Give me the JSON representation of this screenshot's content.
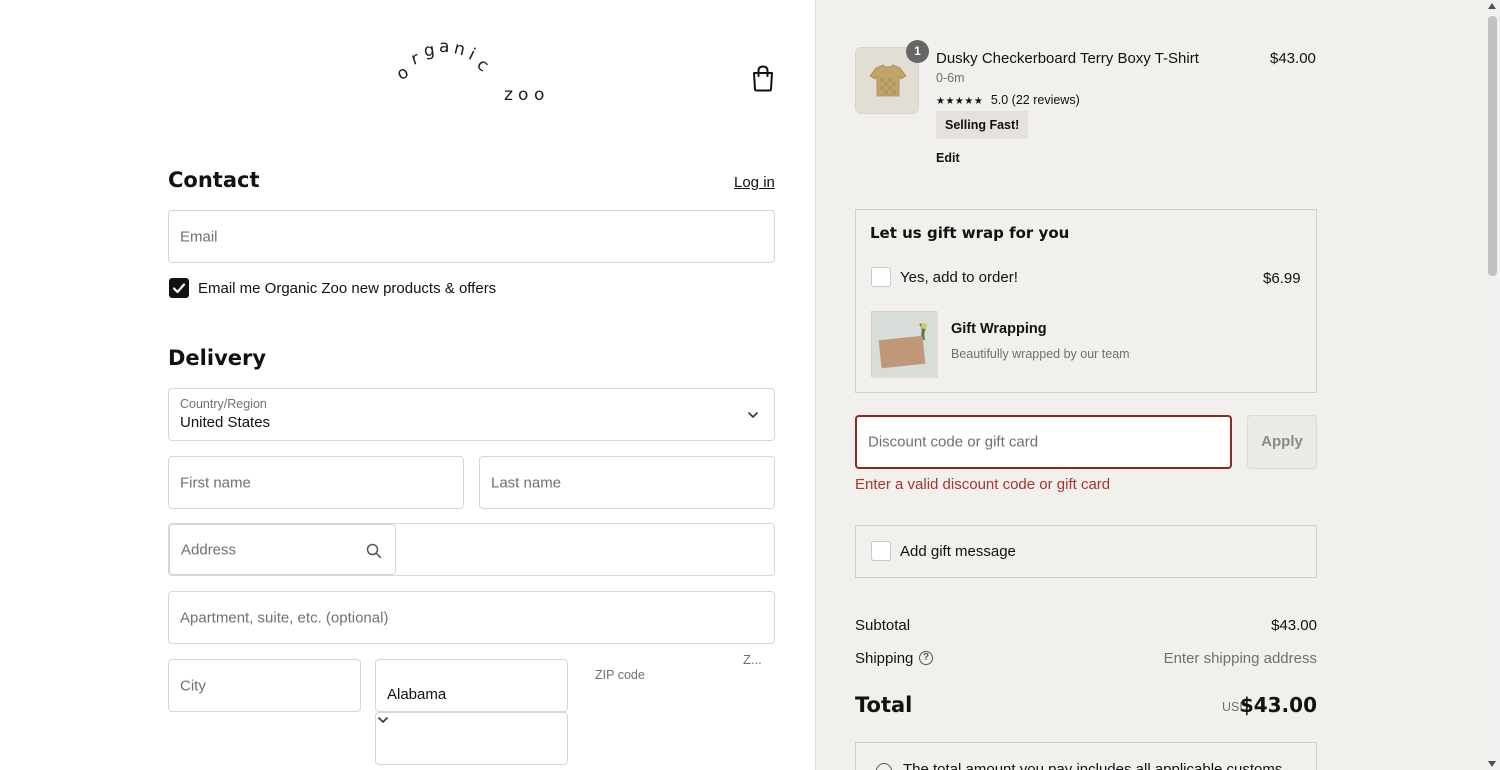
{
  "brand": {
    "logo_text": "organic zoo"
  },
  "contact": {
    "heading": "Contact",
    "login_label": "Log in",
    "email_placeholder": "Email",
    "marketing_checkbox_label": "Email me Organic Zoo new products & offers",
    "marketing_checked": true
  },
  "delivery": {
    "heading": "Delivery",
    "country_label": "Country/Region",
    "country_value": "United States",
    "first_name_placeholder": "First name",
    "last_name_placeholder": "Last name",
    "address_placeholder": "Address",
    "apartment_placeholder": "Apartment, suite, etc. (optional)",
    "city_placeholder": "City",
    "state_value": "Alabama",
    "zip_label": "ZIP code",
    "zip_truncated": "Z..."
  },
  "cart": {
    "item": {
      "quantity": "1",
      "title": "Dusky Checkerboard Terry Boxy T-Shirt",
      "price": "$43.00",
      "variant": "0-6m",
      "rating_stars": "★★★★★",
      "rating_text": "5.0 (22 reviews)",
      "badge": "Selling Fast!",
      "edit_label": "Edit"
    },
    "gift_wrap": {
      "title": "Let us gift wrap for you",
      "checkbox_label": "Yes, add to order!",
      "price": "$6.99",
      "item_name": "Gift Wrapping",
      "item_desc": "Beautifully wrapped by our team"
    },
    "discount": {
      "placeholder": "Discount code or gift card",
      "apply_label": "Apply",
      "error": "Enter a valid discount code or gift card"
    },
    "gift_message_label": "Add gift message",
    "summary": {
      "subtotal_label": "Subtotal",
      "subtotal_value": "$43.00",
      "shipping_label": "Shipping",
      "shipping_value": "Enter shipping address",
      "total_label": "Total",
      "currency": "USD",
      "total_value": "$43.00"
    },
    "duty_notice": "The total amount you pay includes all applicable customs"
  },
  "colors": {
    "error": "#a2372c",
    "summary_bg": "#f2f0ed",
    "checkbox_checked": "#111111"
  }
}
